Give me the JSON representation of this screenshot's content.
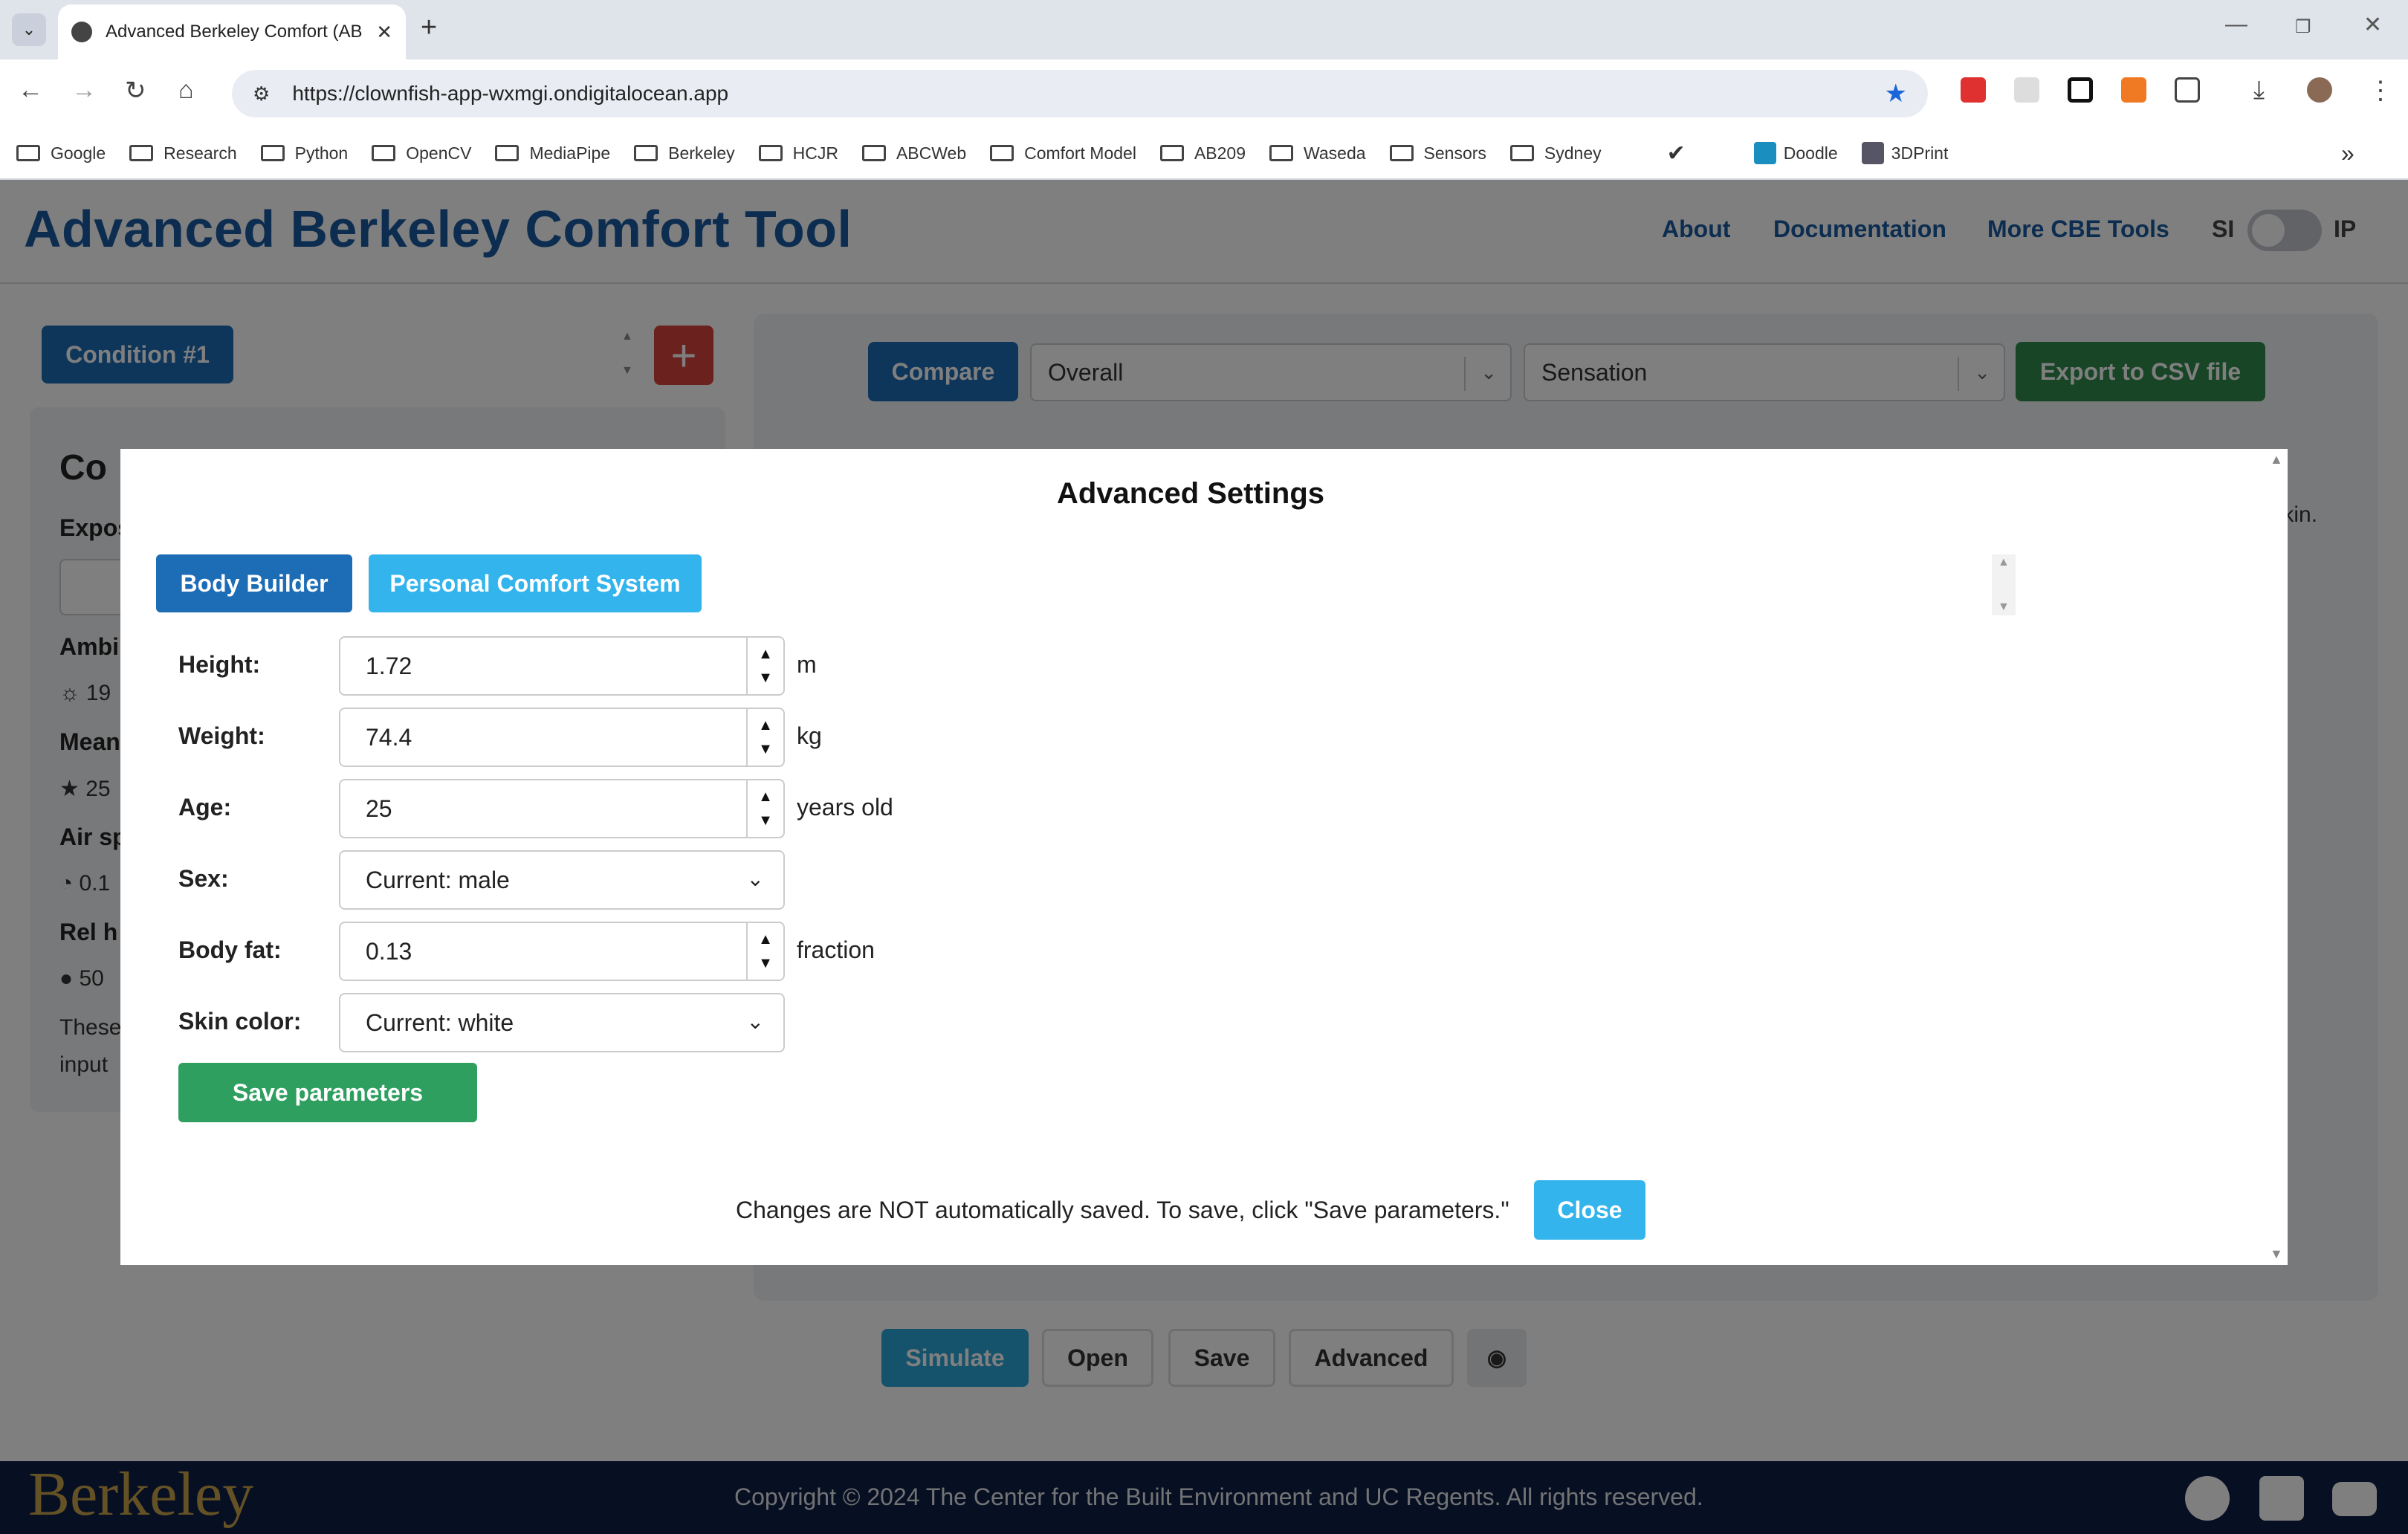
{
  "browser": {
    "tab_title": "Advanced Berkeley Comfort (AB",
    "url": "https://clownfish-app-wxmgi.ondigitalocean.app",
    "bookmarks": [
      "Google",
      "Research",
      "Python",
      "OpenCV",
      "MediaPipe",
      "Berkeley",
      "HCJR",
      "ABCWeb",
      "Comfort Model",
      "AB209",
      "Waseda",
      "Sensors",
      "Sydney",
      "Doodle",
      "3DPrint"
    ]
  },
  "header": {
    "title": "Advanced Berkeley Comfort Tool",
    "nav": [
      "About",
      "Documentation",
      "More CBE Tools"
    ],
    "unit_left": "SI",
    "unit_right": "IP"
  },
  "left": {
    "condition_button": "Condition #1",
    "add_button": "+",
    "card_title_partial": "Co",
    "labels": [
      "Expos",
      "Ambi",
      "Mean",
      "Air sp",
      "Rel h"
    ],
    "values": [
      "19",
      "25",
      "0.1",
      "50"
    ],
    "note_lines": [
      "These",
      "input"
    ]
  },
  "right": {
    "compare": "Compare",
    "overall": "Overall",
    "sensation": "Sensation",
    "export": "Export to CSV file",
    "note_partial": "nikin."
  },
  "bottom_buttons": {
    "simulate": "Simulate",
    "open": "Open",
    "save": "Save",
    "advanced": "Advanced"
  },
  "footer": {
    "logo": "Berkeley",
    "copyright": "Copyright © 2024 The Center for the Built Environment and UC Regents. All rights reserved."
  },
  "modal": {
    "title": "Advanced Settings",
    "tabs": [
      "Body Builder",
      "Personal Comfort System"
    ],
    "fields": {
      "height": {
        "label": "Height:",
        "value": "1.72",
        "unit": "m"
      },
      "weight": {
        "label": "Weight:",
        "value": "74.4",
        "unit": "kg"
      },
      "age": {
        "label": "Age:",
        "value": "25",
        "unit": "years old"
      },
      "sex": {
        "label": "Sex:",
        "value": "Current: male"
      },
      "body_fat": {
        "label": "Body fat:",
        "value": "0.13",
        "unit": "fraction"
      },
      "skin_color": {
        "label": "Skin color:",
        "value": "Current: white"
      }
    },
    "save_button": "Save parameters",
    "note": "Changes are NOT automatically saved. To save, click \"Save parameters.\"",
    "close_button": "Close"
  },
  "colors": {
    "brand_blue": "#1a5aa0",
    "primary": "#1c6db6",
    "info": "#33b4ec",
    "success": "#2f9f60",
    "danger": "#d6453d",
    "footer_bg": "#0f1f44"
  }
}
